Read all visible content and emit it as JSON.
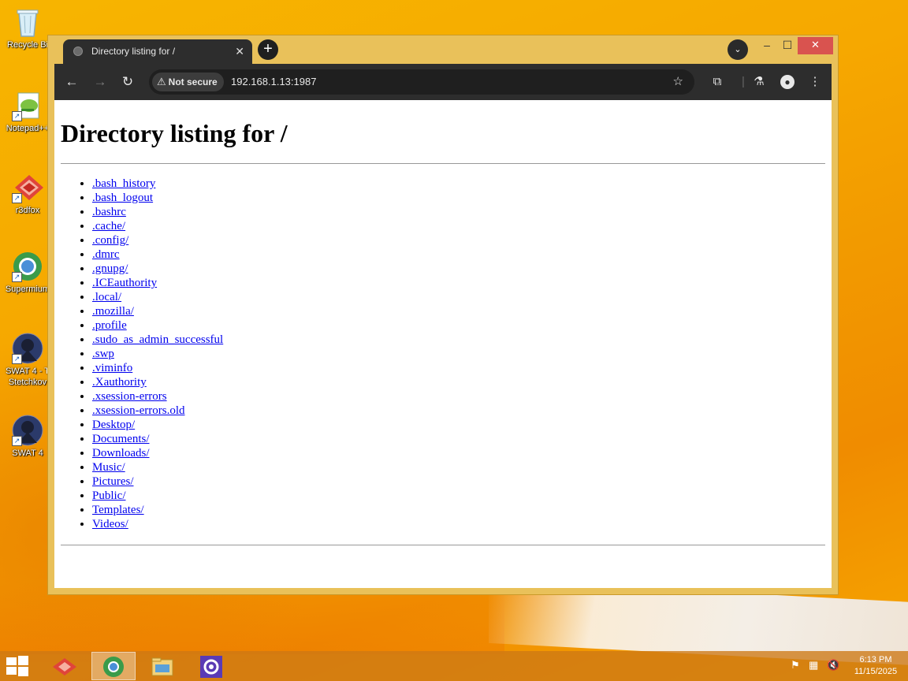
{
  "desktop": {
    "icons": [
      {
        "label": "Recycle Bi"
      },
      {
        "label": "Notepad++"
      },
      {
        "label": "r3dfox"
      },
      {
        "label": "Supermium"
      },
      {
        "label": "SWAT 4 - T",
        "label2": "Stetchkov"
      },
      {
        "label": "SWAT 4"
      }
    ]
  },
  "browser": {
    "tab_title": "Directory listing for /",
    "tab_close": "✕",
    "new_tab": "+",
    "tab_search": "⌄",
    "win_minimize": "–",
    "win_maximize": "☐",
    "win_close": "✕",
    "nav_back": "←",
    "nav_forward": "→",
    "nav_reload": "↻",
    "security_warning": "⚠",
    "security_label": "Not secure",
    "url": "192.168.1.13:1987",
    "bookmark_star": "☆",
    "extensions_icon": "⧉",
    "separator": "|",
    "labs_icon": "⚗",
    "profile_icon": "●",
    "menu_icon": "⋮"
  },
  "page": {
    "heading": "Directory listing for /",
    "entries": [
      ".bash_history",
      ".bash_logout",
      ".bashrc",
      ".cache/",
      ".config/",
      ".dmrc",
      ".gnupg/",
      ".ICEauthority",
      ".local/",
      ".mozilla/",
      ".profile",
      ".sudo_as_admin_successful",
      ".swp",
      ".viminfo",
      ".Xauthority",
      ".xsession-errors",
      ".xsession-errors.old",
      "Desktop/",
      "Documents/",
      "Downloads/",
      "Music/",
      "Pictures/",
      "Public/",
      "Templates/",
      "Videos/"
    ]
  },
  "taskbar": {
    "apps": [
      {
        "name": "r3dfox",
        "glyph": "🦊"
      },
      {
        "name": "supermium",
        "glyph": "◉"
      },
      {
        "name": "file-explorer",
        "glyph": "▤"
      },
      {
        "name": "settings",
        "glyph": "⚙"
      }
    ],
    "tray": [
      {
        "name": "flag",
        "glyph": "⚑"
      },
      {
        "name": "network",
        "glyph": "▦"
      },
      {
        "name": "volume",
        "glyph": "🔇"
      }
    ],
    "time": "6:13 PM",
    "date": "11/15/2025"
  }
}
